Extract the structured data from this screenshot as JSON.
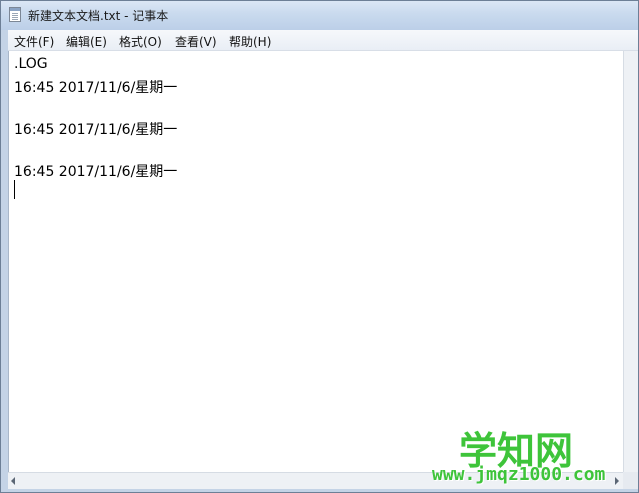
{
  "window": {
    "title": "新建文本文档.txt - 记事本"
  },
  "menu": {
    "items": [
      {
        "label": "文件(F)"
      },
      {
        "label": "编辑(E)"
      },
      {
        "label": "格式(O)"
      },
      {
        "label": "查看(V)"
      },
      {
        "label": "帮助(H)"
      }
    ]
  },
  "editor": {
    "lines": [
      ".LOG",
      "16:45 2017/11/6/星期一",
      "",
      "16:45 2017/11/6/星期一",
      "",
      "16:45 2017/11/6/星期一"
    ]
  },
  "watermark": {
    "title": "学知网",
    "url": "www.jmqz1000.com"
  },
  "icons": {
    "app": "notepad-icon",
    "scroll_left": "arrow-left-icon",
    "scroll_right": "arrow-right-icon"
  }
}
